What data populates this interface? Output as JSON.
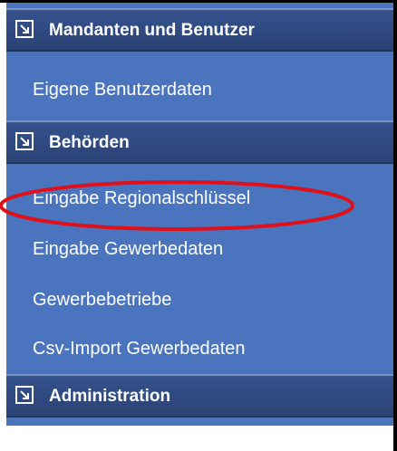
{
  "sections": [
    {
      "title": "Mandanten und Benutzer",
      "toggle_icon": "collapse-square-icon",
      "items": [
        {
          "label": "Eigene Benutzerdaten"
        }
      ]
    },
    {
      "title": "Behörden",
      "toggle_icon": "collapse-square-icon",
      "items": [
        {
          "label": "Eingabe Regionalschlüssel",
          "highlighted": true
        },
        {
          "label": "Eingabe Gewerbedaten"
        },
        {
          "label": "Gewerbebetriebe"
        },
        {
          "label": "Csv-Import Gewerbedaten"
        }
      ]
    },
    {
      "title": "Administration",
      "toggle_icon": "collapse-square-icon",
      "items": []
    }
  ],
  "colors": {
    "menu_background": "#4a74bd",
    "header_background": "#2f4a83",
    "highlight_circle": "#e0101a",
    "text": "#ffffff"
  }
}
